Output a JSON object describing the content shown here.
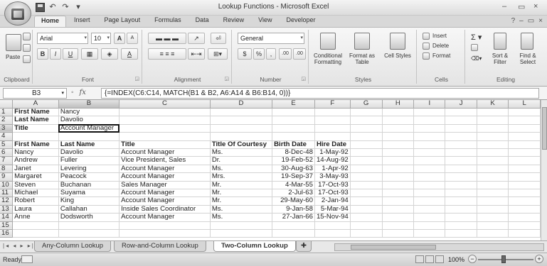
{
  "window": {
    "title": "Lookup Functions - Microsoft Excel",
    "controls": [
      "–",
      "▭",
      "×"
    ]
  },
  "ribbon": {
    "tabs": [
      "Home",
      "Insert",
      "Page Layout",
      "Formulas",
      "Data",
      "Review",
      "View",
      "Developer"
    ],
    "active_tab": "Home",
    "right_controls": [
      "?",
      "–",
      "▭",
      "×"
    ],
    "clipboard": {
      "label": "Clipboard",
      "paste": "Paste"
    },
    "font": {
      "label": "Font",
      "name": "Arial",
      "size": "10",
      "bold": "B",
      "italic": "I",
      "underline": "U",
      "grow": "A",
      "shrink": "A"
    },
    "alignment": {
      "label": "Alignment"
    },
    "number": {
      "label": "Number",
      "format": "General",
      "currency": "$",
      "percent": "%",
      "comma": ",",
      "inc_dec": ".00",
      "dec_dec": ".00"
    },
    "styles": {
      "label": "Styles",
      "conditional": "Conditional Formatting",
      "format_table": "Format as Table",
      "cell_styles": "Cell Styles"
    },
    "cells": {
      "label": "Cells",
      "insert": "Insert",
      "delete": "Delete",
      "format": "Format"
    },
    "editing": {
      "label": "Editing",
      "sort": "Sort & Filter",
      "find": "Find & Select"
    }
  },
  "formula_bar": {
    "name_box": "B3",
    "fx": "fx",
    "formula": "{=INDEX(C6:C14, MATCH(B1 & B2, A6:A14 & B6:B14, 0))}"
  },
  "columns": [
    "A",
    "B",
    "C",
    "D",
    "E",
    "F",
    "G",
    "H",
    "I",
    "J",
    "K",
    "L"
  ],
  "selected_cell": {
    "row": 3,
    "col": "B"
  },
  "rows": [
    {
      "n": "1",
      "cells": [
        "First Name",
        "Nancy",
        "",
        "",
        "",
        ""
      ]
    },
    {
      "n": "2",
      "cells": [
        "Last Name",
        "Davolio",
        "",
        "",
        "",
        ""
      ]
    },
    {
      "n": "3",
      "cells": [
        "Title",
        "Account Manager",
        "",
        "",
        "",
        ""
      ]
    },
    {
      "n": "4",
      "cells": [
        "",
        "",
        "",
        "",
        "",
        ""
      ]
    },
    {
      "n": "5",
      "cells": [
        "First Name",
        "Last Name",
        "Title",
        "Title Of Courtesy",
        "Birth Date",
        "Hire Date"
      ]
    },
    {
      "n": "6",
      "cells": [
        "Nancy",
        "Davolio",
        "Account Manager",
        "Ms.",
        "8-Dec-48",
        "1-May-92"
      ]
    },
    {
      "n": "7",
      "cells": [
        "Andrew",
        "Fuller",
        "Vice President, Sales",
        "Dr.",
        "19-Feb-52",
        "14-Aug-92"
      ]
    },
    {
      "n": "8",
      "cells": [
        "Janet",
        "Levering",
        "Account Manager",
        "Ms.",
        "30-Aug-63",
        "1-Apr-92"
      ]
    },
    {
      "n": "9",
      "cells": [
        "Margaret",
        "Peacock",
        "Account Manager",
        "Mrs.",
        "19-Sep-37",
        "3-May-93"
      ]
    },
    {
      "n": "10",
      "cells": [
        "Steven",
        "Buchanan",
        "Sales Manager",
        "Mr.",
        "4-Mar-55",
        "17-Oct-93"
      ]
    },
    {
      "n": "11",
      "cells": [
        "Michael",
        "Suyama",
        "Account Manager",
        "Mr.",
        "2-Jul-63",
        "17-Oct-93"
      ]
    },
    {
      "n": "12",
      "cells": [
        "Robert",
        "King",
        "Account Manager",
        "Mr.",
        "29-May-60",
        "2-Jan-94"
      ]
    },
    {
      "n": "13",
      "cells": [
        "Laura",
        "Callahan",
        "Inside Sales Coordinator",
        "Ms.",
        "9-Jan-58",
        "5-Mar-94"
      ]
    },
    {
      "n": "14",
      "cells": [
        "Anne",
        "Dodsworth",
        "Account Manager",
        "Ms.",
        "27-Jan-66",
        "15-Nov-94"
      ]
    },
    {
      "n": "15",
      "cells": [
        "",
        "",
        "",
        "",
        "",
        ""
      ]
    },
    {
      "n": "16",
      "cells": [
        "",
        "",
        "",
        "",
        "",
        ""
      ]
    }
  ],
  "sheet_tabs": [
    "Any-Column Lookup",
    "Row-and-Column Lookup",
    "Two-Column Lookup"
  ],
  "active_sheet": "Two-Column Lookup",
  "status": {
    "text": "Ready",
    "zoom": "100%"
  }
}
